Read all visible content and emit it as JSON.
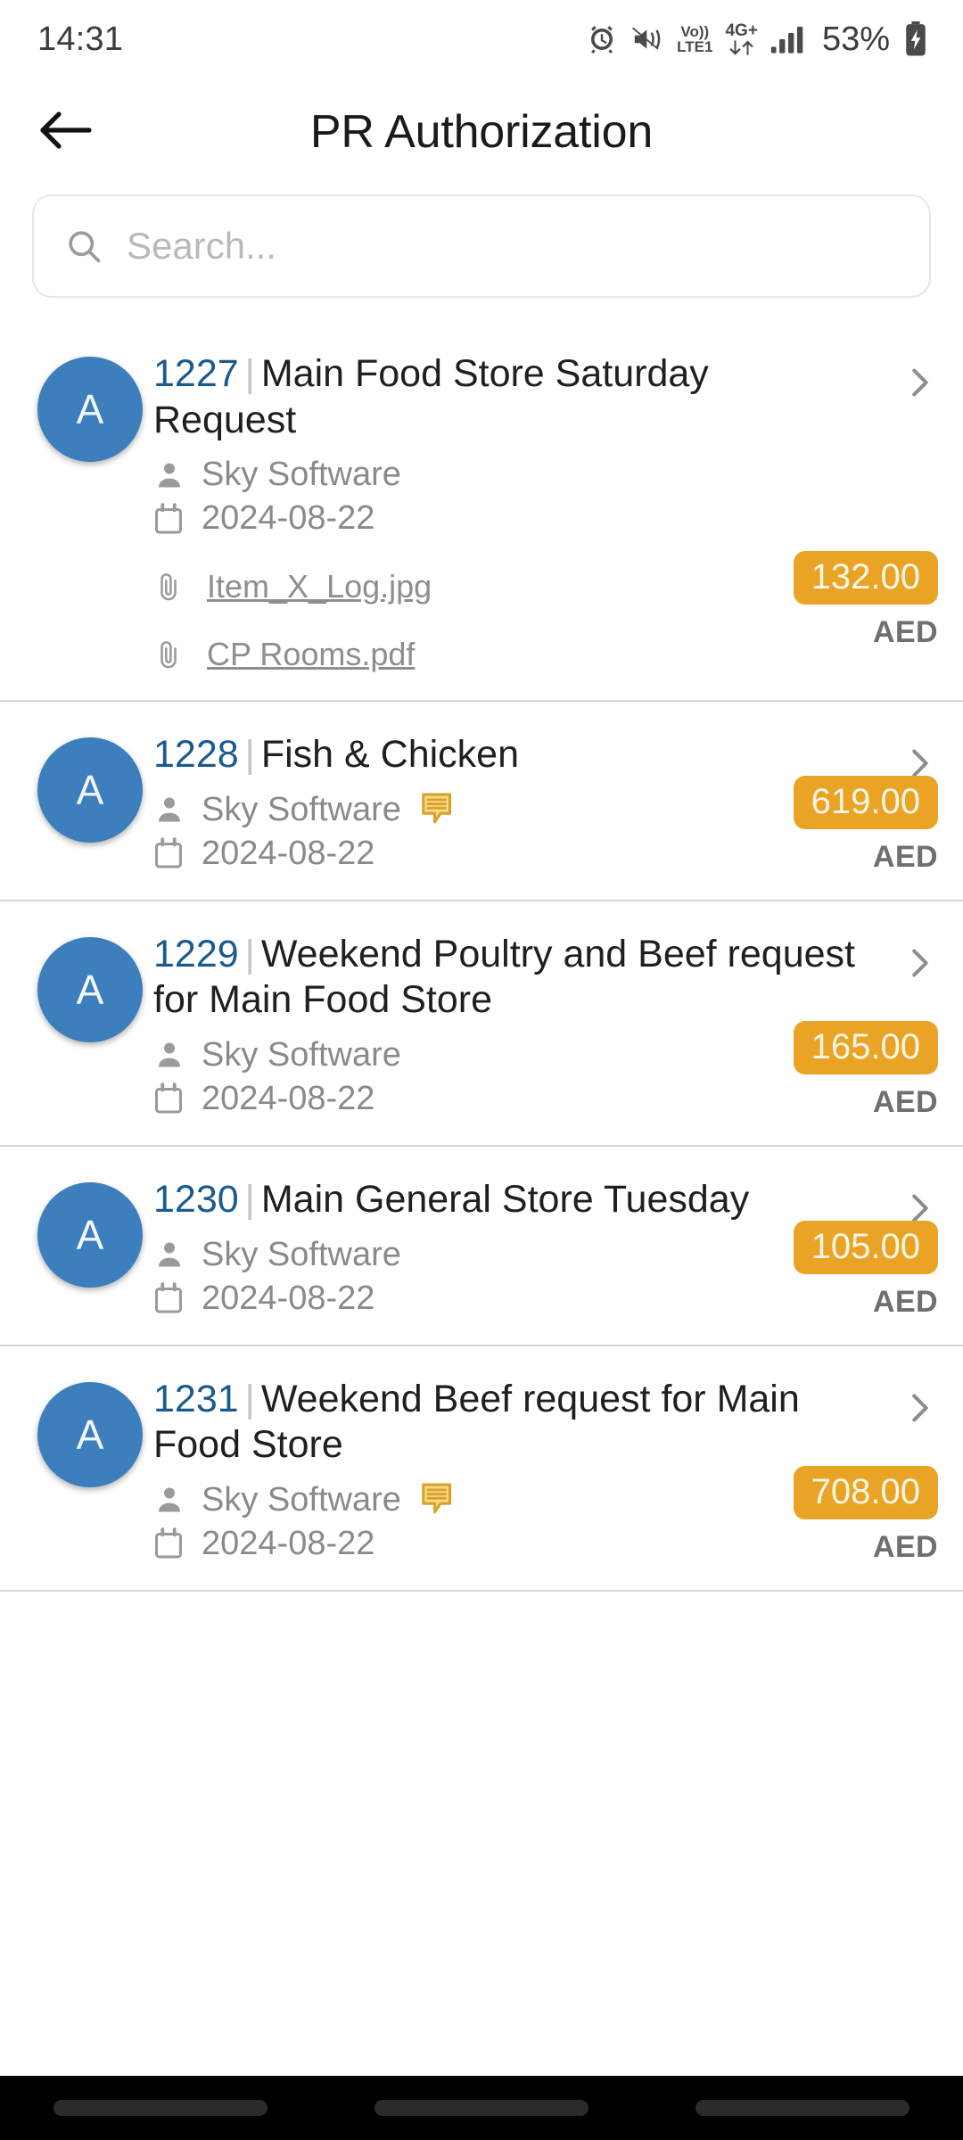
{
  "status_bar": {
    "clock": "14:31",
    "battery_percent": "53%",
    "network_label_top": "Vo))",
    "network_label_bottom": "LTE1",
    "data_label": "4G+",
    "icons": [
      "alarm-icon",
      "mute-vibrate-icon",
      "volte-icon",
      "mobile-data-icon",
      "signal-bars-icon",
      "battery-charging-icon"
    ]
  },
  "app_bar": {
    "title": "PR Authorization",
    "back_icon": "back-arrow-icon"
  },
  "search": {
    "value": "",
    "placeholder": "Search...",
    "icon": "search-icon"
  },
  "list": {
    "items": [
      {
        "avatar_letter": "A",
        "doc_no": "1227",
        "separator": "|",
        "title": "Main Food Store Saturday Request",
        "requester": "Sky Software",
        "date": "2024-08-22",
        "amount": "132.00",
        "currency": "AED",
        "has_comment": false,
        "attachments": [
          "Item_X_Log.jpg",
          "CP Rooms.pdf"
        ]
      },
      {
        "avatar_letter": "A",
        "doc_no": "1228",
        "separator": "|",
        "title": "Fish & Chicken",
        "requester": "Sky Software",
        "date": "2024-08-22",
        "amount": "619.00",
        "currency": "AED",
        "has_comment": true,
        "attachments": []
      },
      {
        "avatar_letter": "A",
        "doc_no": "1229",
        "separator": "|",
        "title": "Weekend Poultry and Beef request for Main Food Store",
        "requester": "Sky Software",
        "date": "2024-08-22",
        "amount": "165.00",
        "currency": "AED",
        "has_comment": false,
        "attachments": []
      },
      {
        "avatar_letter": "A",
        "doc_no": "1230",
        "separator": "|",
        "title": "Main General Store Tuesday",
        "requester": "Sky Software",
        "date": "2024-08-22",
        "amount": "105.00",
        "currency": "AED",
        "has_comment": false,
        "attachments": []
      },
      {
        "avatar_letter": "A",
        "doc_no": "1231",
        "separator": "|",
        "title": "Weekend Beef request for Main Food Store",
        "requester": "Sky Software",
        "date": "2024-08-22",
        "amount": "708.00",
        "currency": "AED",
        "has_comment": true,
        "attachments": []
      }
    ]
  },
  "colors": {
    "avatar_blue": "#3d7ebd",
    "doc_no_blue": "#1a5a8e",
    "amount_amber": "#e9a426",
    "comment_amber": "#d9a22a",
    "divider_gray": "#d6d6d9"
  },
  "nav_bar": {
    "pills": [
      "recents-pill",
      "home-pill",
      "back-pill"
    ]
  }
}
